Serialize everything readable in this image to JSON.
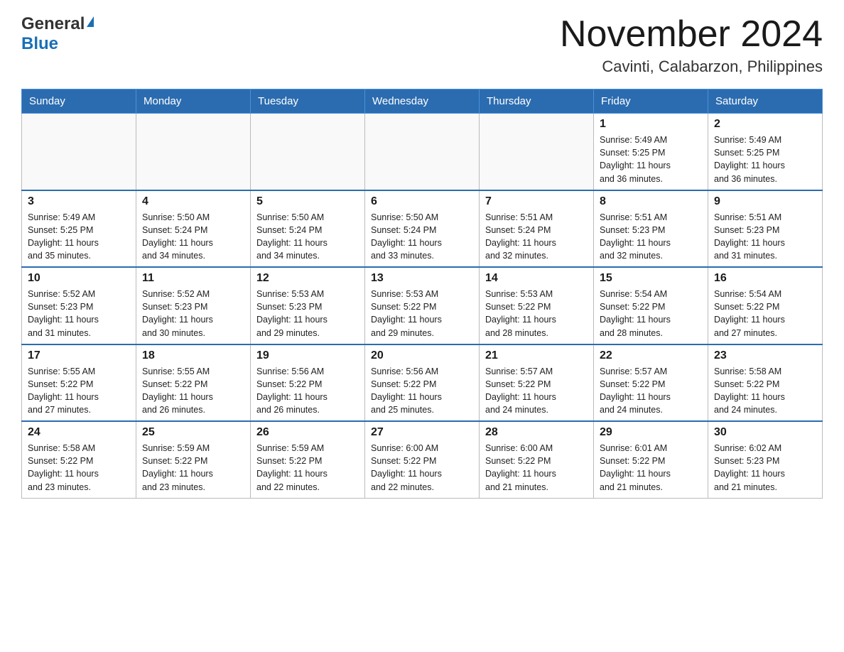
{
  "header": {
    "logo_general": "General",
    "logo_blue": "Blue",
    "month_title": "November 2024",
    "location": "Cavinti, Calabarzon, Philippines"
  },
  "days_of_week": [
    "Sunday",
    "Monday",
    "Tuesday",
    "Wednesday",
    "Thursday",
    "Friday",
    "Saturday"
  ],
  "weeks": [
    {
      "days": [
        {
          "num": "",
          "info": ""
        },
        {
          "num": "",
          "info": ""
        },
        {
          "num": "",
          "info": ""
        },
        {
          "num": "",
          "info": ""
        },
        {
          "num": "",
          "info": ""
        },
        {
          "num": "1",
          "info": "Sunrise: 5:49 AM\nSunset: 5:25 PM\nDaylight: 11 hours\nand 36 minutes."
        },
        {
          "num": "2",
          "info": "Sunrise: 5:49 AM\nSunset: 5:25 PM\nDaylight: 11 hours\nand 36 minutes."
        }
      ]
    },
    {
      "days": [
        {
          "num": "3",
          "info": "Sunrise: 5:49 AM\nSunset: 5:25 PM\nDaylight: 11 hours\nand 35 minutes."
        },
        {
          "num": "4",
          "info": "Sunrise: 5:50 AM\nSunset: 5:24 PM\nDaylight: 11 hours\nand 34 minutes."
        },
        {
          "num": "5",
          "info": "Sunrise: 5:50 AM\nSunset: 5:24 PM\nDaylight: 11 hours\nand 34 minutes."
        },
        {
          "num": "6",
          "info": "Sunrise: 5:50 AM\nSunset: 5:24 PM\nDaylight: 11 hours\nand 33 minutes."
        },
        {
          "num": "7",
          "info": "Sunrise: 5:51 AM\nSunset: 5:24 PM\nDaylight: 11 hours\nand 32 minutes."
        },
        {
          "num": "8",
          "info": "Sunrise: 5:51 AM\nSunset: 5:23 PM\nDaylight: 11 hours\nand 32 minutes."
        },
        {
          "num": "9",
          "info": "Sunrise: 5:51 AM\nSunset: 5:23 PM\nDaylight: 11 hours\nand 31 minutes."
        }
      ]
    },
    {
      "days": [
        {
          "num": "10",
          "info": "Sunrise: 5:52 AM\nSunset: 5:23 PM\nDaylight: 11 hours\nand 31 minutes."
        },
        {
          "num": "11",
          "info": "Sunrise: 5:52 AM\nSunset: 5:23 PM\nDaylight: 11 hours\nand 30 minutes."
        },
        {
          "num": "12",
          "info": "Sunrise: 5:53 AM\nSunset: 5:23 PM\nDaylight: 11 hours\nand 29 minutes."
        },
        {
          "num": "13",
          "info": "Sunrise: 5:53 AM\nSunset: 5:22 PM\nDaylight: 11 hours\nand 29 minutes."
        },
        {
          "num": "14",
          "info": "Sunrise: 5:53 AM\nSunset: 5:22 PM\nDaylight: 11 hours\nand 28 minutes."
        },
        {
          "num": "15",
          "info": "Sunrise: 5:54 AM\nSunset: 5:22 PM\nDaylight: 11 hours\nand 28 minutes."
        },
        {
          "num": "16",
          "info": "Sunrise: 5:54 AM\nSunset: 5:22 PM\nDaylight: 11 hours\nand 27 minutes."
        }
      ]
    },
    {
      "days": [
        {
          "num": "17",
          "info": "Sunrise: 5:55 AM\nSunset: 5:22 PM\nDaylight: 11 hours\nand 27 minutes."
        },
        {
          "num": "18",
          "info": "Sunrise: 5:55 AM\nSunset: 5:22 PM\nDaylight: 11 hours\nand 26 minutes."
        },
        {
          "num": "19",
          "info": "Sunrise: 5:56 AM\nSunset: 5:22 PM\nDaylight: 11 hours\nand 26 minutes."
        },
        {
          "num": "20",
          "info": "Sunrise: 5:56 AM\nSunset: 5:22 PM\nDaylight: 11 hours\nand 25 minutes."
        },
        {
          "num": "21",
          "info": "Sunrise: 5:57 AM\nSunset: 5:22 PM\nDaylight: 11 hours\nand 24 minutes."
        },
        {
          "num": "22",
          "info": "Sunrise: 5:57 AM\nSunset: 5:22 PM\nDaylight: 11 hours\nand 24 minutes."
        },
        {
          "num": "23",
          "info": "Sunrise: 5:58 AM\nSunset: 5:22 PM\nDaylight: 11 hours\nand 24 minutes."
        }
      ]
    },
    {
      "days": [
        {
          "num": "24",
          "info": "Sunrise: 5:58 AM\nSunset: 5:22 PM\nDaylight: 11 hours\nand 23 minutes."
        },
        {
          "num": "25",
          "info": "Sunrise: 5:59 AM\nSunset: 5:22 PM\nDaylight: 11 hours\nand 23 minutes."
        },
        {
          "num": "26",
          "info": "Sunrise: 5:59 AM\nSunset: 5:22 PM\nDaylight: 11 hours\nand 22 minutes."
        },
        {
          "num": "27",
          "info": "Sunrise: 6:00 AM\nSunset: 5:22 PM\nDaylight: 11 hours\nand 22 minutes."
        },
        {
          "num": "28",
          "info": "Sunrise: 6:00 AM\nSunset: 5:22 PM\nDaylight: 11 hours\nand 21 minutes."
        },
        {
          "num": "29",
          "info": "Sunrise: 6:01 AM\nSunset: 5:22 PM\nDaylight: 11 hours\nand 21 minutes."
        },
        {
          "num": "30",
          "info": "Sunrise: 6:02 AM\nSunset: 5:23 PM\nDaylight: 11 hours\nand 21 minutes."
        }
      ]
    }
  ]
}
